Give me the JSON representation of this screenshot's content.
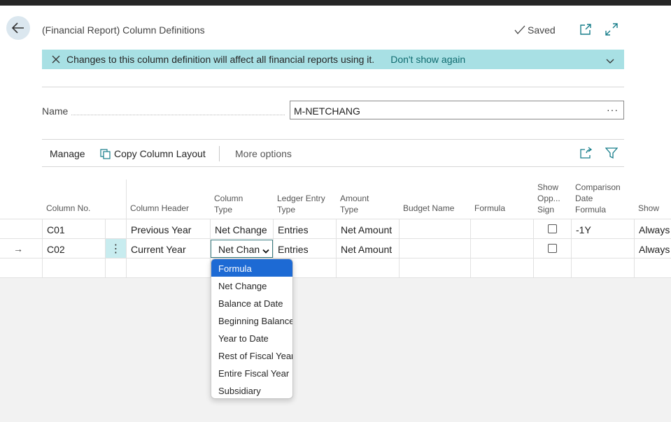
{
  "header": {
    "title": "(Financial Report) Column Definitions",
    "saved_label": "Saved"
  },
  "banner": {
    "message": "Changes to this column definition will affect all financial reports using it.",
    "link": "Don't show again"
  },
  "name_field": {
    "label": "Name",
    "value": "M-NETCHANG",
    "more": "···"
  },
  "toolbar": {
    "manage": "Manage",
    "copy_layout": "Copy Column Layout",
    "more_options": "More options"
  },
  "grid": {
    "headers": {
      "column_no": "Column No.",
      "column_header": "Column Header",
      "column_type": [
        "Column",
        "Type"
      ],
      "ledger_entry_type": [
        "Ledger Entry",
        "Type"
      ],
      "amount_type": [
        "Amount",
        "Type"
      ],
      "budget_name": "Budget Name",
      "formula": "Formula",
      "show_opp_sign": [
        "Show",
        "Opp...",
        "Sign"
      ],
      "comparison_date_formula": [
        "Comparison",
        "Date",
        "Formula"
      ],
      "show": "Show"
    },
    "rows": [
      {
        "column_no": "C01",
        "column_header": "Previous Year",
        "column_type": "Net Change",
        "ledger_entry_type": "Entries",
        "amount_type": "Net Amount",
        "budget_name": "",
        "formula": "",
        "show_opp_sign": false,
        "comparison_date_formula": "-1Y",
        "show": "Always"
      },
      {
        "column_no": "C02",
        "column_header": "Current Year",
        "column_type": "Net Chan",
        "ledger_entry_type": "Entries",
        "amount_type": "Net Amount",
        "budget_name": "",
        "formula": "",
        "show_opp_sign": false,
        "comparison_date_formula": "",
        "show": "Always"
      }
    ],
    "current_row_indicator": "→",
    "row_menu": "⋮"
  },
  "dropdown": {
    "options": [
      "Formula",
      "Net Change",
      "Balance at Date",
      "Beginning Balance",
      "Year to Date",
      "Rest of Fiscal Year",
      "Entire Fiscal Year",
      "Subsidiary"
    ],
    "highlighted": "Formula"
  },
  "colors": {
    "banner_bg": "#a8e0e4",
    "link": "#0f6b6f",
    "accent": "#1d6ad4",
    "back_button_bg": "#dbe7ef",
    "row_menu_bg": "#c8ecef",
    "icon_teal": "#167d8a"
  }
}
